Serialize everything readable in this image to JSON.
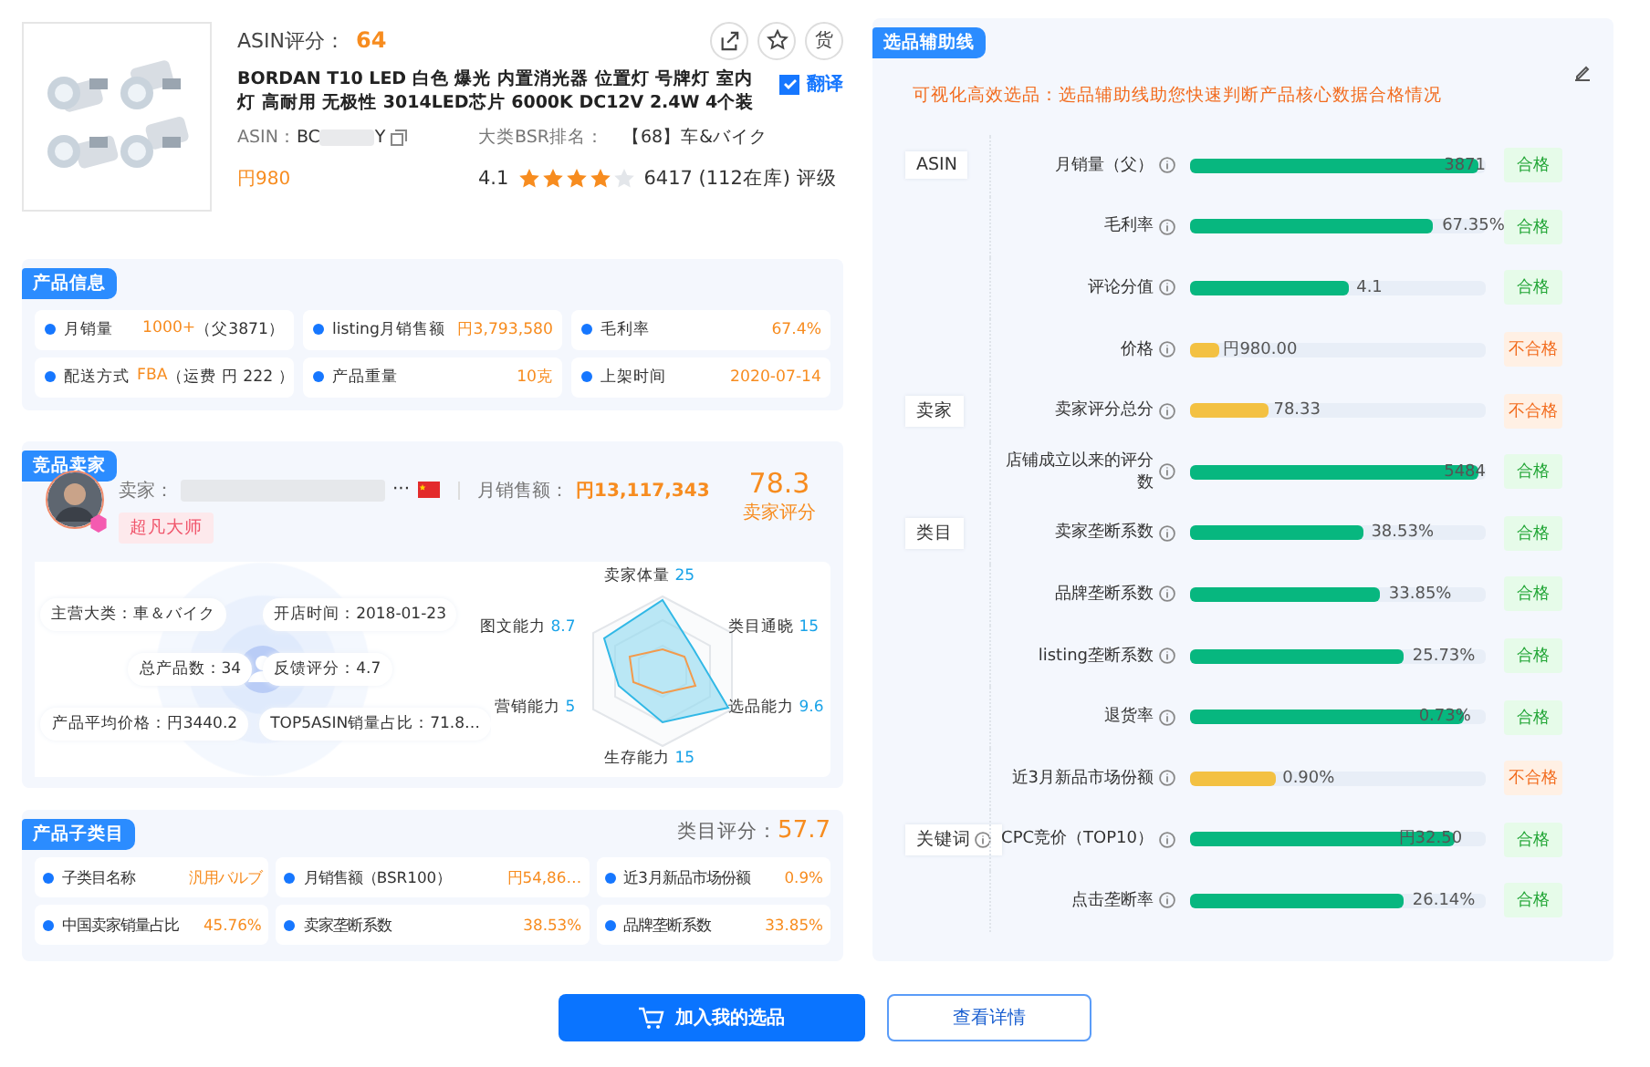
{
  "product": {
    "score_label": "ASIN评分：",
    "score": "64",
    "icon_buttons": [
      {
        "kind": "share"
      },
      {
        "kind": "favorite"
      },
      {
        "kind": "text",
        "label": "货"
      }
    ],
    "title": "BORDAN T10 LED 白色 爆光 内置消光器 位置灯 号牌灯 室内灯 高耐用 无极性 3014LED芯片 6000K DC12V 2.4W 4个装",
    "translate": {
      "label": "翻译",
      "checked": true
    },
    "asin_label": "ASIN：",
    "asin_start": "BC",
    "asin_end": "Y",
    "bsr_label": "大类BSR排名：",
    "bsr": "【68】车&バイク",
    "price": "円980",
    "rating": "4.1",
    "stars": 4,
    "reviews": "6417 (112在库) 评级"
  },
  "product_info": {
    "title": "产品信息",
    "items": [
      {
        "label": "月销量",
        "value": "1000+",
        "extra": "（父3871）"
      },
      {
        "label": "listing月销售额",
        "value": "円3,793,580"
      },
      {
        "label": "毛利率",
        "value": "67.4%"
      },
      {
        "label": "配送方式",
        "value": "FBA",
        "extra": "（运费 円 222 ）"
      },
      {
        "label": "产品重量",
        "value": "10克"
      },
      {
        "label": "上架时间",
        "value": "2020-07-14"
      }
    ]
  },
  "seller": {
    "title": "竞品卖家",
    "name_label": "卖家：",
    "name_end": "···",
    "sales_label": "月销售额：",
    "sales": "円13,117,343",
    "rank": "超凡大师",
    "score": "78.3",
    "score_label": "卖家评分",
    "stats_left": [
      "主营大类：車＆バイク",
      "总产品数：34",
      "产品平均价格：円3440.2"
    ],
    "stats_right": [
      "开店时间：2018-01-23",
      "反馈评分：4.7",
      "TOP5ASIN销量占比：71.8…"
    ],
    "radar": [
      {
        "name": "卖家体量",
        "value": "25"
      },
      {
        "name": "类目通晓",
        "value": "15"
      },
      {
        "name": "选品能力",
        "value": "9.6"
      },
      {
        "name": "生存能力",
        "value": "15"
      },
      {
        "name": "营销能力",
        "value": "5"
      },
      {
        "name": "图文能力",
        "value": "8.7"
      }
    ]
  },
  "subcategory": {
    "title": "产品子类目",
    "score_label": "类目评分：",
    "score": "57.7",
    "items": [
      {
        "label": "子类目名称",
        "value": "汎用バルブ"
      },
      {
        "label": "月销售额（BSR100）",
        "value": "円54,86…"
      },
      {
        "label": "近3月新品市场份额",
        "value": "0.9%"
      },
      {
        "label": "中国卖家销量占比",
        "value": "45.76%"
      },
      {
        "label": "卖家垄断系数",
        "value": "38.53%"
      },
      {
        "label": "品牌垄断系数",
        "value": "33.85%"
      }
    ]
  },
  "guide": {
    "title": "选品辅助线",
    "subtitle": "可视化高效选品：选品辅助线助您快速判断产品核心数据合格情况",
    "groups": [
      {
        "name": "ASIN",
        "info": false,
        "rows": [
          {
            "label": "月销量（父）",
            "level": 1,
            "value": "3871",
            "status": "合格",
            "pass": true
          },
          {
            "label": "毛利率",
            "level": 0.84,
            "value": "67.35%",
            "status": "合格",
            "pass": true
          },
          {
            "label": "评论分值",
            "level": 0.55,
            "value": "4.1",
            "status": "合格",
            "pass": true
          },
          {
            "label": "价格",
            "level": 0.1,
            "value": "円980.00",
            "status": "不合格",
            "pass": false
          }
        ]
      },
      {
        "name": "卖家",
        "info": false,
        "rows": [
          {
            "label": "卖家评分总分",
            "level": 0.27,
            "value": "78.33",
            "status": "不合格",
            "pass": false
          },
          {
            "label": "店铺成立以来的评分数",
            "level": 1,
            "value": "5484",
            "status": "合格",
            "pass": true
          }
        ]
      },
      {
        "name": "类目",
        "info": false,
        "rows": [
          {
            "label": "卖家垄断系数",
            "level": 0.6,
            "value": "38.53%",
            "status": "合格",
            "pass": true
          },
          {
            "label": "品牌垄断系数",
            "level": 0.66,
            "value": "33.85%",
            "status": "合格",
            "pass": true
          },
          {
            "label": "listing垄断系数",
            "level": 0.74,
            "value": "25.73%",
            "status": "合格",
            "pass": true
          },
          {
            "label": "退货率",
            "level": 0.95,
            "value": "0.73%",
            "status": "合格",
            "pass": true
          },
          {
            "label": "近3月新品市场份额",
            "level": 0.3,
            "value": "0.90%",
            "status": "不合格",
            "pass": false
          }
        ]
      },
      {
        "name": "关键词",
        "info": true,
        "rows": [
          {
            "label": "CPC竞价（TOP10）",
            "level": 0.92,
            "value": "円32.50",
            "status": "合格",
            "pass": true
          },
          {
            "label": "点击垄断率",
            "level": 0.74,
            "value": "26.14%",
            "status": "合格",
            "pass": true
          }
        ]
      }
    ]
  },
  "buttons": [
    {
      "label": "加入我的选品",
      "kind": "primary"
    },
    {
      "label": "查看详情",
      "kind": "secondary"
    }
  ]
}
